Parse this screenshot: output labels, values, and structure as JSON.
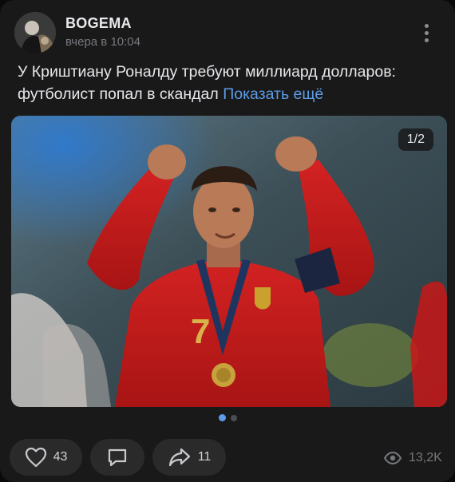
{
  "post": {
    "author": "BOGEMA",
    "time": "вчера в 10:04",
    "text": "У Криштиану Роналду требуют миллиард долларов: футболист попал в скандал",
    "show_more": "Показать ещё",
    "photo": {
      "counter": "1/2",
      "total": 2,
      "current": 1
    },
    "actions": {
      "likes": "43",
      "shares": "11",
      "views": "13,2K"
    }
  },
  "icons": {
    "avatar": "avatar",
    "more": "more-vertical-icon",
    "like": "heart-icon",
    "comment": "comment-icon",
    "share": "share-arrow-icon",
    "views": "eye-icon"
  },
  "colors": {
    "background": "#191919",
    "accent": "#5c9ce6",
    "text": "#e6e7eb",
    "muted": "#76787d"
  }
}
